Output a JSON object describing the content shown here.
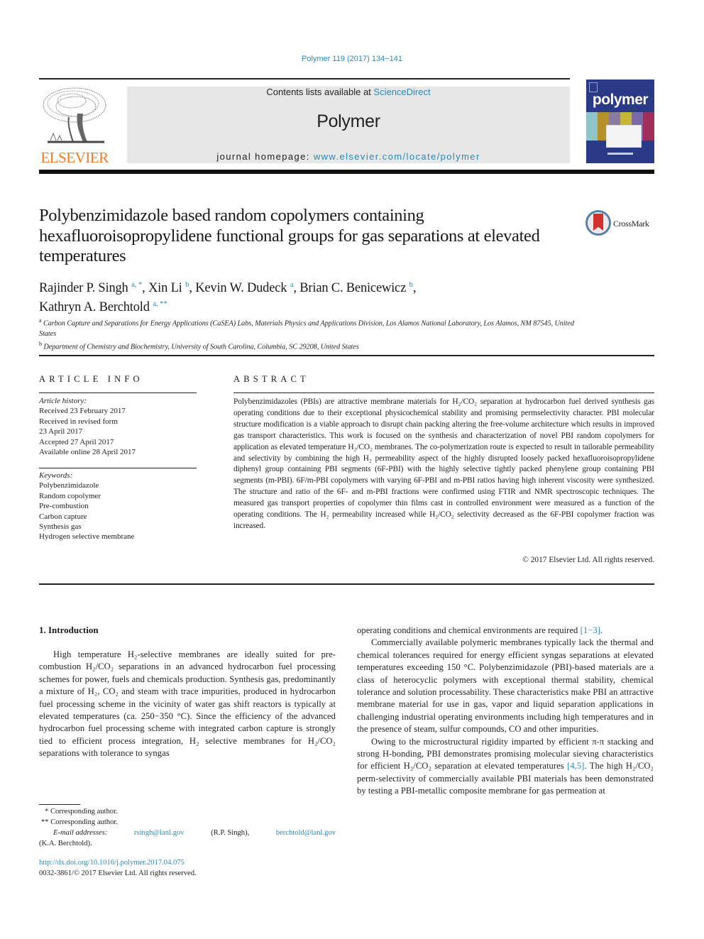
{
  "header": {
    "citation": "Polymer 119 (2017) 134−141",
    "publisher_logo_text": "ELSEVIER",
    "contents_prefix": "Contents lists available at ",
    "contents_link": "ScienceDirect",
    "journal_title": "Polymer",
    "homepage_prefix": "journal homepage: ",
    "homepage_link": "www.elsevier.com/locate/polymer",
    "cover_title": "polymer",
    "crossmark_label": "CrossMark"
  },
  "article": {
    "title": "Polybenzimidazole based random copolymers containing hexafluoroisopropylidene functional groups for gas separations at elevated temperatures",
    "authors": [
      {
        "name": "Rajinder P. Singh",
        "sup": "a, *",
        "sep": ", "
      },
      {
        "name": "Xin Li",
        "sup": "b",
        "sep": ", "
      },
      {
        "name": "Kevin W. Dudeck",
        "sup": "a",
        "sep": ", "
      },
      {
        "name": "Brian C. Benicewicz",
        "sup": "b",
        "sep": ","
      },
      {
        "name": "Kathryn A. Berchtold",
        "sup": "a, **",
        "sep": ""
      }
    ],
    "affiliations": [
      {
        "key": "a",
        "text": "Carbon Capture and Separations for Energy Applications (CaSEA) Labs, Materials Physics and Applications Division, Los Alamos National Laboratory, Los Alamos, NM 87545, United States"
      },
      {
        "key": "b",
        "text": "Department of Chemistry and Biochemistry, University of South Carolina, Columbia, SC 29208, United States"
      }
    ]
  },
  "article_info": {
    "heading": "ARTICLE INFO",
    "history_label": "Article history:",
    "history": [
      "Received 23 February 2017",
      "Received in revised form",
      "23 April 2017",
      "Accepted 27 April 2017",
      "Available online 28 April 2017"
    ],
    "keywords_label": "Keywords:",
    "keywords": [
      "Polybenzimidazole",
      "Random copolymer",
      "Pre-combustion",
      "Carbon capture",
      "Synthesis gas",
      "Hydrogen selective membrane"
    ]
  },
  "abstract": {
    "heading": "ABSTRACT",
    "text": "Polybenzimidazoles (PBIs) are attractive membrane materials for H₂/CO₂ separation at hydrocarbon fuel derived synthesis gas operating conditions due to their exceptional physicochemical stability and promising permselectivity character. PBI molecular structure modification is a viable approach to disrupt chain packing altering the free-volume architecture which results in improved gas transport characteristics. This work is focused on the synthesis and characterization of novel PBI random copolymers for application as elevated temperature H₂/CO₂ membranes. The co-polymerization route is expected to result in tailorable permeability and selectivity by combining the high H₂ permeability aspect of the highly disrupted loosely packed hexafluoroisopropylidene diphenyl group containing PBI segments (6F-PBI) with the highly selective tightly packed phenylene group containing PBI segments (m-PBI). 6F/m-PBI copolymers with varying 6F-PBI and m-PBI ratios having high inherent viscosity were synthesized. The structure and ratio of the 6F- and m-PBI fractions were confirmed using FTIR and NMR spectroscopic techniques. The measured gas transport properties of copolymer thin films cast in controlled environment were measured as a function of the operating conditions. The H₂ permeability increased while H₂/CO₂ selectivity decreased as the 6F-PBI copolymer fraction was increased.",
    "copyright": "© 2017 Elsevier Ltd. All rights reserved."
  },
  "body": {
    "section_heading": "1.  Introduction",
    "left_paragraph": "High temperature H₂-selective membranes are ideally suited for pre-combustion H₂/CO₂ separations in an advanced hydrocarbon fuel processing schemes for power, fuels and chemicals production. Synthesis gas, predominantly a mixture of H₂, CO₂ and steam with trace impurities, produced in hydrocarbon fuel processing scheme in the vicinity of water gas shift reactors is typically at elevated temperatures (ca. 250−350 °C). Since the efficiency of the advanced hydrocarbon fuel processing scheme with integrated carbon capture is strongly tied to efficient process integration, H₂ selective membranes for H₂/CO₂ separations with tolerance to syngas",
    "right_p1_text": "operating conditions and chemical environments are required ",
    "right_p1_ref": "[1−3]",
    "right_p1_end": ".",
    "right_p2": "Commercially available polymeric membranes typically lack the thermal and chemical tolerances required for energy efficient syngas separations at elevated temperatures exceeding 150 °C. Polybenzimidazole (PBI)-based materials are a class of heterocyclic polymers with exceptional thermal stability, chemical tolerance and solution processability. These characteristics make PBI an attractive membrane material for use in gas, vapor and liquid separation applications in challenging industrial operating environments including high temperatures and in the presence of steam, sulfur compounds, CO and other impurities.",
    "right_p3_a": "Owing to the microstructural rigidity imparted by efficient π-π stacking and strong H-bonding, PBI demonstrates promising molecular sieving characteristics for efficient H₂/CO₂ separation at elevated temperatures ",
    "right_p3_ref": "[4,5]",
    "right_p3_b": ". The high H₂/CO₂ perm-selectivity of commercially available PBI materials has been demonstrated by testing a PBI-metallic composite membrane for gas permeation at"
  },
  "footnotes": {
    "fn1": "*  Corresponding author.",
    "fn2": "**  Corresponding author.",
    "email_label": "E-mail addresses:",
    "email1": "rsingh@lanl.gov",
    "email1_owner": "(R.P. Singh),",
    "email2": "berchtold@lanl.gov",
    "email2_owner": "(K.A. Berchtold).",
    "doi": "http://dx.doi.org/10.1016/j.polymer.2017.04.075",
    "issn": "0032-3861/© 2017 Elsevier Ltd. All rights reserved."
  },
  "colors": {
    "link": "#2a8ab8",
    "elsevier_orange": "#f07a22",
    "masthead_bg": "#e7e7e7",
    "cover_blue": "#2b3a86",
    "crossmark_red": "#d2322d"
  }
}
